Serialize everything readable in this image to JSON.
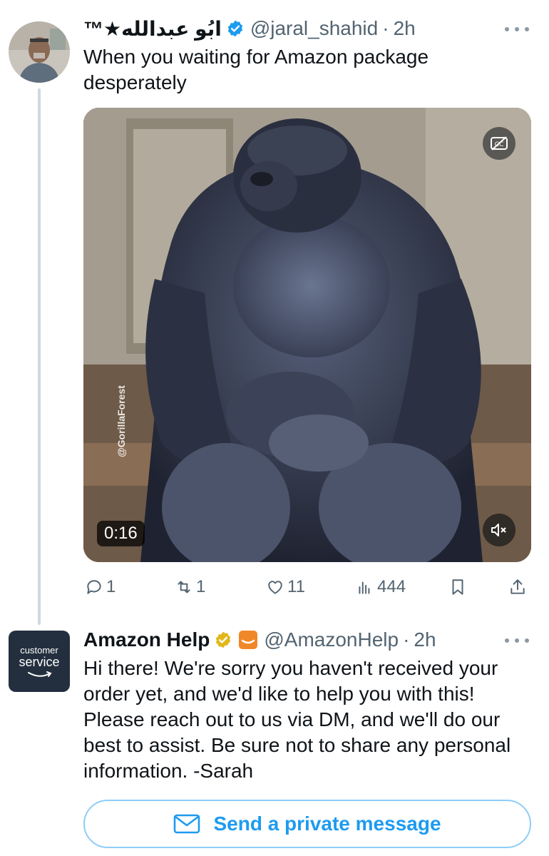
{
  "tweet1": {
    "display_name": "ابُو عبدالله★™",
    "handle": "@jaral_shahid",
    "separator": "·",
    "time": "2h",
    "text": "When you waiting for Amazon package desperately",
    "media": {
      "duration": "0:16",
      "watermark": "@GorillaForest"
    },
    "stats": {
      "replies": "1",
      "reposts": "1",
      "likes": "11",
      "views": "444"
    }
  },
  "tweet2": {
    "display_name": "Amazon Help",
    "handle": "@AmazonHelp",
    "separator": "·",
    "time": "2h",
    "avatar_line1": "customer",
    "avatar_line2": "service",
    "text": "Hi there! We're sorry you haven't received your order yet, and we'd like to help you with this! Please reach out to us via DM, and we'll do our best to assist. Be sure not to share any personal information. -Sarah",
    "dm_button_label": "Send a private message"
  },
  "colors": {
    "accent": "#1d9bf0",
    "secondary_text": "#536471",
    "verified_blue": "#1d9bf0",
    "verified_gold": "#e2b719",
    "amazon_orange": "#f0882a",
    "amazon_avatar_bg": "#232f3e"
  },
  "icons": [
    "more-icon",
    "verified-icon",
    "cc-icon",
    "mute-icon",
    "reply-icon",
    "repost-icon",
    "like-icon",
    "views-icon",
    "bookmark-icon",
    "share-icon",
    "mail-icon"
  ]
}
